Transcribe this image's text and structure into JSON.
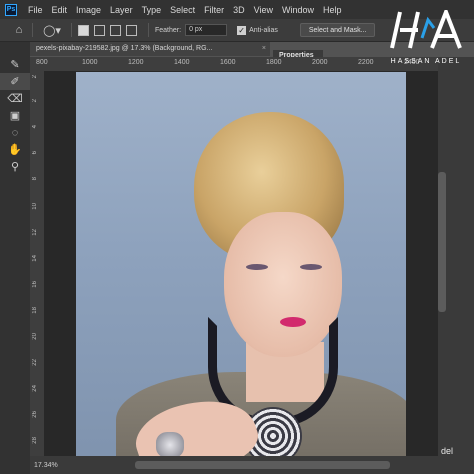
{
  "app": {
    "logo": "Ps",
    "menus": [
      "File",
      "Edit",
      "Image",
      "Layer",
      "Type",
      "Select",
      "Filter",
      "3D",
      "View",
      "Window",
      "Help"
    ]
  },
  "options_bar": {
    "feather_label": "Feather:",
    "feather_value": "0 px",
    "antialias_label": "Anti-alias",
    "antialias_checked": true,
    "select_mask_label": "Select and Mask..."
  },
  "document": {
    "tab_title": "pexels-pixabay-219582.jpg @ 17.3% (Background, RG...",
    "zoom": "17.34%"
  },
  "panels": {
    "properties_label": "Properties"
  },
  "rulers": {
    "horizontal": [
      "800",
      "1000",
      "1200",
      "1400",
      "1600",
      "1800",
      "2000",
      "2200",
      "2400"
    ],
    "vertical": [
      "2",
      "2",
      "4",
      "6",
      "8",
      "10",
      "12",
      "14",
      "16",
      "18",
      "20",
      "22",
      "24",
      "26",
      "28"
    ]
  },
  "watermark": {
    "name": "HASSAN ADEL",
    "partial": "del"
  },
  "colors": {
    "accent": "#31a8ff",
    "menubar": "#323232",
    "lips": "#d22a6d"
  }
}
